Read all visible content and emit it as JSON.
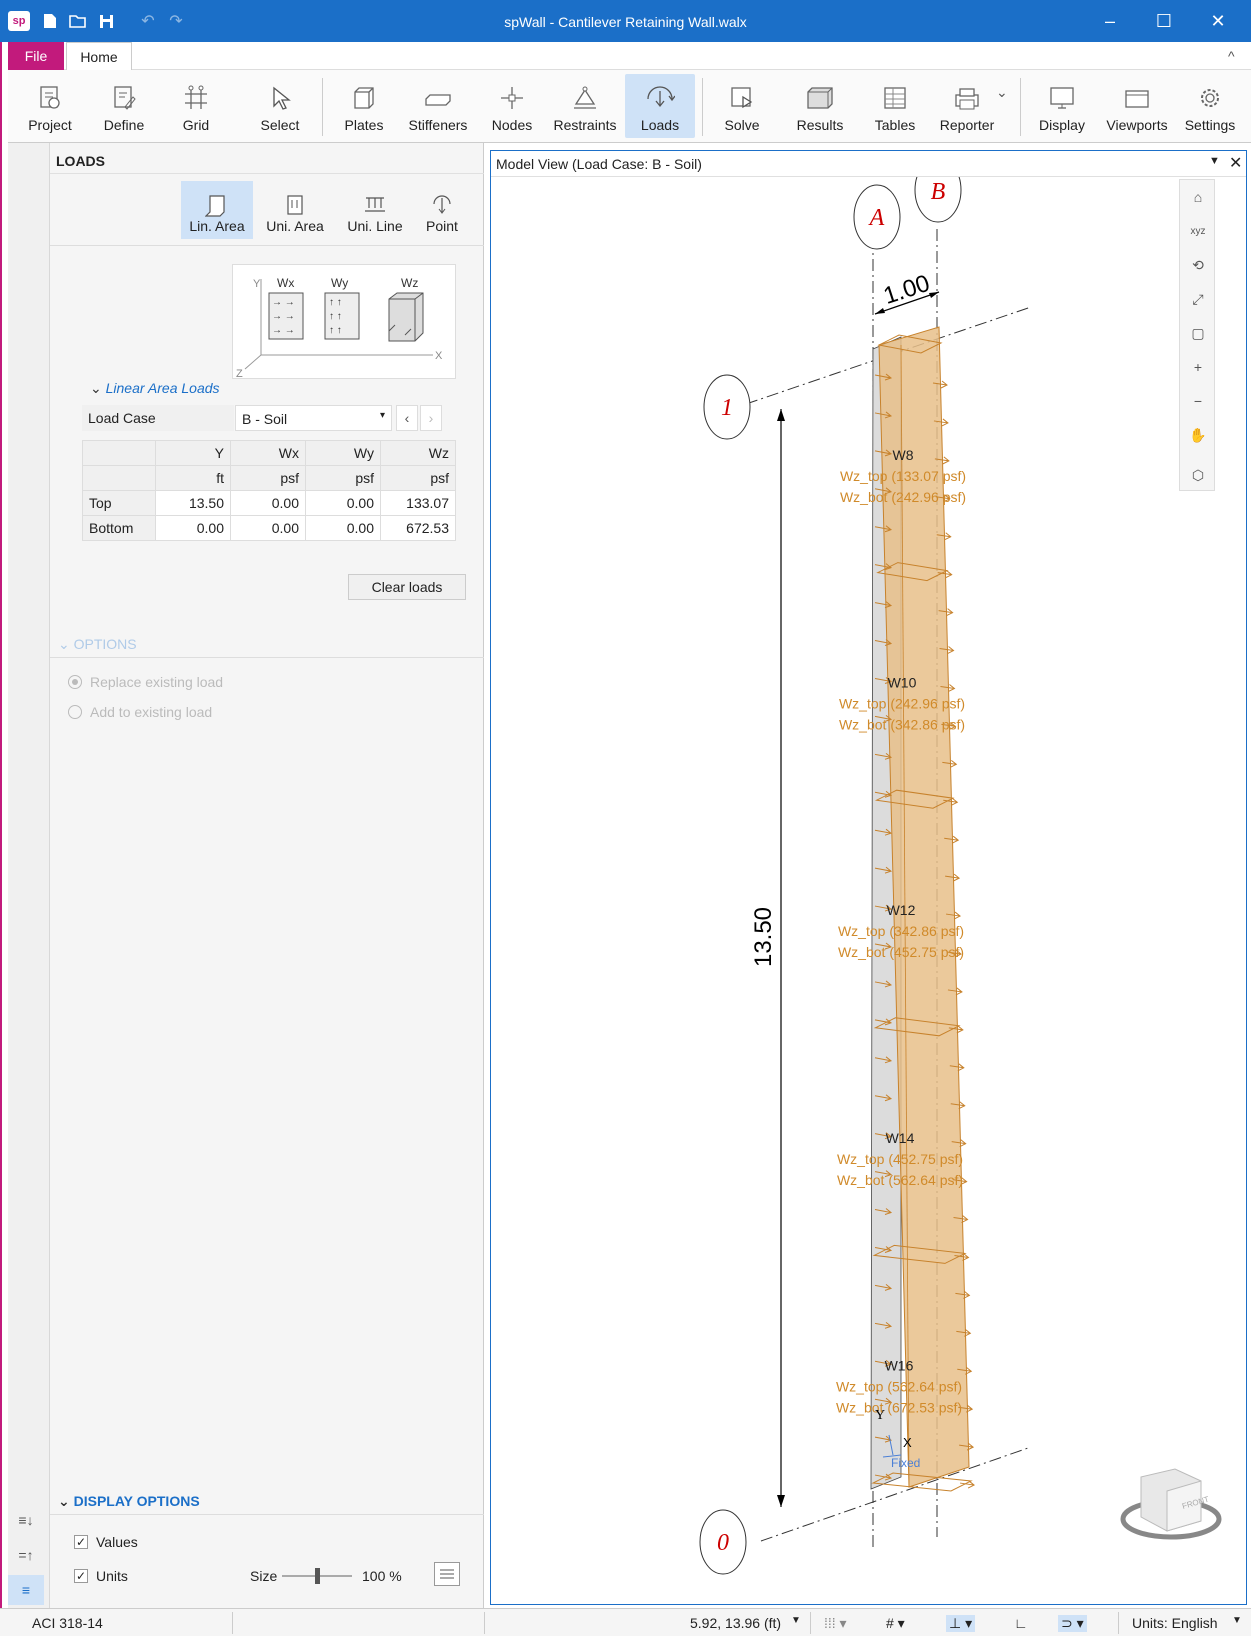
{
  "titlebar": {
    "title": "spWall - Cantilever Retaining Wall.walx",
    "logo": "sp",
    "quick_access_icons": [
      "new-file-icon",
      "open-folder-icon",
      "save-icon",
      "undo-icon",
      "redo-icon"
    ],
    "window_controls": {
      "minimize": "–",
      "maximize": "☐",
      "close": "✕"
    }
  },
  "menubar": {
    "file": "File",
    "home": "Home",
    "collapse": "^"
  },
  "ribbon": {
    "buttons": [
      "Project",
      "Define",
      "Grid",
      "Select",
      "Plates",
      "Stiffeners",
      "Nodes",
      "Restraints",
      "Loads",
      "Solve",
      "Results",
      "Tables",
      "Reporter",
      "Display",
      "Viewports",
      "Settings"
    ],
    "active": "Loads"
  },
  "panel": {
    "title": "LOADS",
    "load_types": [
      "Lin. Area",
      "Uni. Area",
      "Uni. Line",
      "Point"
    ],
    "active_load_type": "Lin. Area",
    "diagram": {
      "axis_y": "Y",
      "axis_z": "Z",
      "axis_x": "X",
      "labels": [
        "Wx",
        "Wy",
        "Wz"
      ]
    },
    "section_title": "Linear Area Loads",
    "load_case_label": "Load Case",
    "load_case_value": "B - Soil",
    "table": {
      "headers": [
        "Y",
        "Wx",
        "Wy",
        "Wz"
      ],
      "units": [
        "ft",
        "psf",
        "psf",
        "psf"
      ],
      "rows": [
        {
          "label": "Top",
          "values": [
            "13.50",
            "0.00",
            "0.00",
            "133.07"
          ]
        },
        {
          "label": "Bottom",
          "values": [
            "0.00",
            "0.00",
            "0.00",
            "672.53"
          ]
        }
      ]
    },
    "clear_button": "Clear loads",
    "options": {
      "title": "OPTIONS",
      "replace": "Replace existing load",
      "add": "Add to existing load"
    },
    "display_options": {
      "title": "DISPLAY OPTIONS",
      "values_label": "Values",
      "units_label": "Units",
      "size_label": "Size",
      "size_value": "100 %",
      "size_fraction": 0.5
    }
  },
  "model_view": {
    "title": "Model View (Load Case: B - Soil)",
    "grid_labels": {
      "a": "A",
      "b": "B",
      "one": "1",
      "zero": "0"
    },
    "dim_width": "1.00",
    "dim_height": "13.50",
    "walls": [
      {
        "name": "W8",
        "top": "Wz_top (133.07 psf)",
        "bot": "Wz_bot (242.96 psf)"
      },
      {
        "name": "W10",
        "top": "Wz_top (242.96 psf)",
        "bot": "Wz_bot (342.86 psf)"
      },
      {
        "name": "W12",
        "top": "Wz_top (342.86 psf)",
        "bot": "Wz_bot (452.75 psf)"
      },
      {
        "name": "W14",
        "top": "Wz_top (452.75 psf)",
        "bot": "Wz_bot (562.64 psf)"
      },
      {
        "name": "W16",
        "top": "Wz_top (562.64 psf)",
        "bot": "Wz_bot (672.53 psf)"
      }
    ],
    "axis_y": "Y",
    "axis_x": "X",
    "fixed_label": "Fixed",
    "view_cube_label": "FRONT"
  },
  "statusbar": {
    "code": "ACI 318-14",
    "coords": "5.92, 13.96 (ft)",
    "units": "Units: English"
  },
  "colors": {
    "accent": "#1b6fc8",
    "file_tab": "#c21a7c",
    "load": "#e8c08a",
    "load_text": "#d08a2a",
    "grid_label": "#cc0000"
  }
}
